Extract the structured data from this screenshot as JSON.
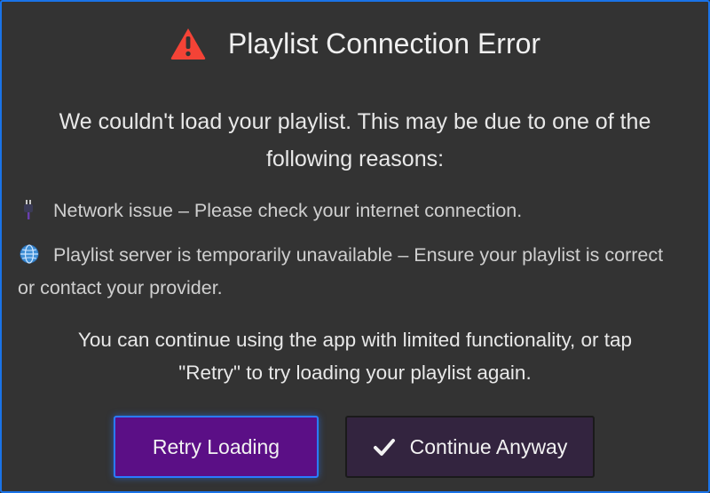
{
  "dialog": {
    "title": "Playlist Connection Error",
    "title_icon": "warning-triangle-icon",
    "accent_color": "#e53935",
    "intro_line1": "We couldn't load your playlist. This may be due to one of the",
    "intro_line2": "following reasons:",
    "reasons": [
      {
        "icon": "plug-icon",
        "text": "Network issue – Please check your internet connection."
      },
      {
        "icon": "globe-icon",
        "text": "Playlist server is temporarily unavailable – Ensure your playlist is correct or contact your provider."
      }
    ],
    "note_line1": "You can continue using the app with limited functionality, or tap",
    "note_line2": "\"Retry\" to try loading your playlist again.",
    "buttons": {
      "retry_label": "Retry Loading",
      "continue_label": "Continue Anyway",
      "continue_icon": "checkmark-icon"
    },
    "colors": {
      "background": "#333333",
      "retry_button": "#5b0f86",
      "continue_button": "#33243f",
      "focus_border": "#2a7bff"
    }
  }
}
